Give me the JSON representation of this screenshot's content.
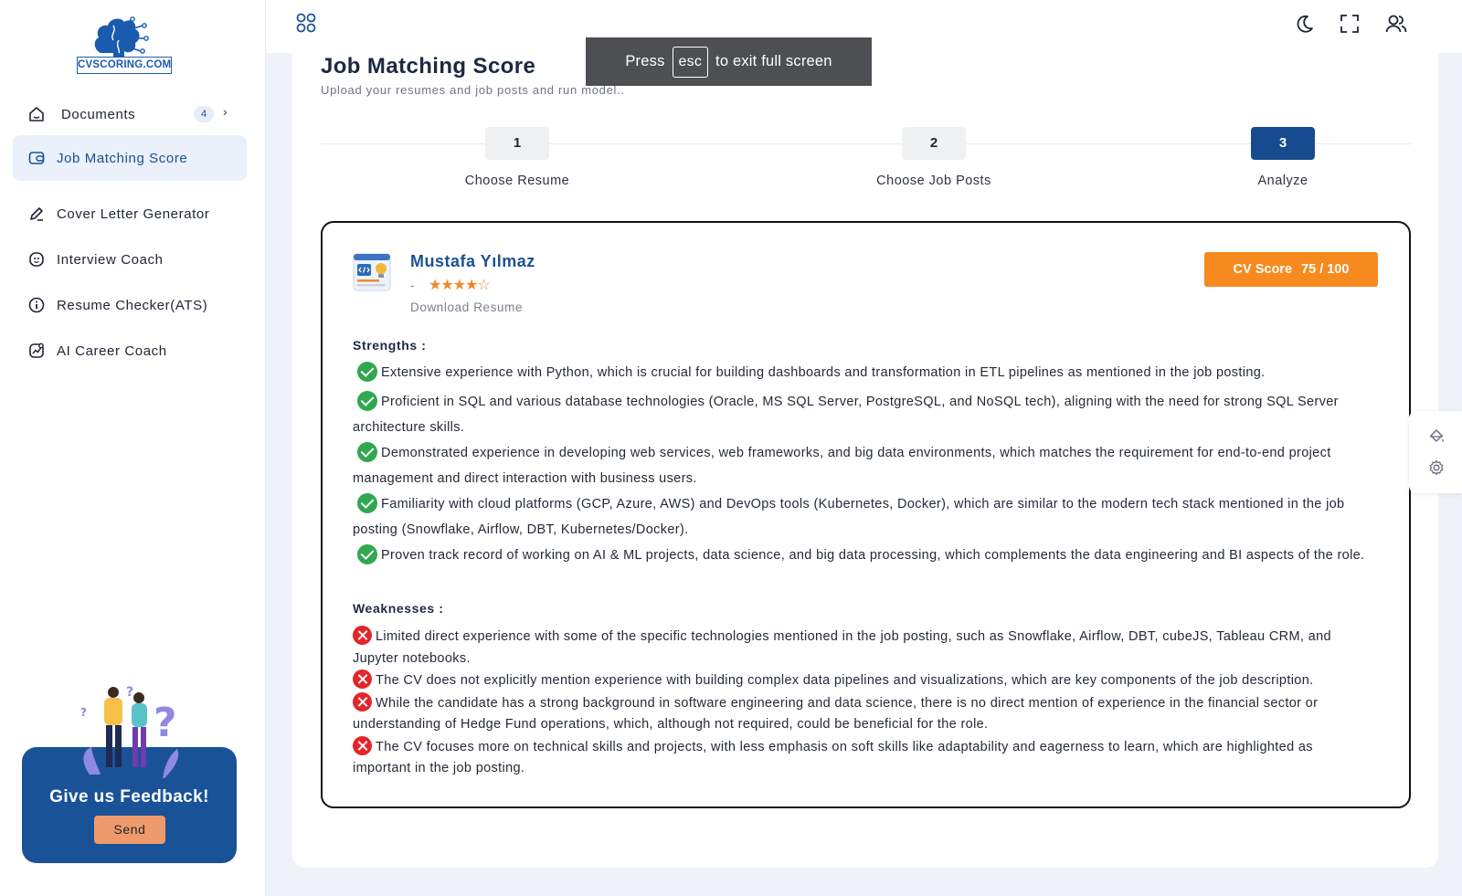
{
  "brand": {
    "logo_text": "CVSCORING.COM"
  },
  "sidebar": {
    "items": [
      {
        "label": "Documents",
        "icon": "home-icon",
        "badge": "4"
      },
      {
        "label": "Job Matching Score",
        "icon": "wallet-icon",
        "active": true
      },
      {
        "label": "Cover Letter Generator",
        "icon": "pen-icon"
      },
      {
        "label": "Interview Coach",
        "icon": "face-icon"
      },
      {
        "label": "Resume Checker(ATS)",
        "icon": "info-icon"
      },
      {
        "label": "AI Career Coach",
        "icon": "chart-icon"
      }
    ],
    "feedback": {
      "title": "Give us Feedback!",
      "button": "Send"
    }
  },
  "topbar": {
    "icons": [
      "apps-icon",
      "moon-icon",
      "fullscreen-icon",
      "users-icon"
    ]
  },
  "toast": {
    "prefix": "Press",
    "key": "esc",
    "suffix": "to exit full screen"
  },
  "page": {
    "title": "Job Matching Score",
    "subtitle": "Upload your resumes and job posts and run model..",
    "steps": [
      {
        "number": "1",
        "label": "Choose Resume"
      },
      {
        "number": "2",
        "label": "Choose Job Posts"
      },
      {
        "number": "3",
        "label": "Analyze",
        "active": true
      }
    ]
  },
  "result": {
    "candidate_name": "Mustafa Yılmaz",
    "dash": "-",
    "stars": "★★★★☆",
    "rating": 4,
    "download_label": "Download Resume",
    "score_label": "CV Score",
    "score_value": "75 / 100",
    "strengths_title": "Strengths :",
    "strengths": [
      "Extensive experience with Python, which is crucial for building dashboards and transformation in ETL pipelines as mentioned in the job posting.",
      "Proficient in SQL and various database technologies (Oracle, MS SQL Server, PostgreSQL, and NoSQL tech), aligning with the need for strong SQL Server architecture skills.",
      "Demonstrated experience in developing web services, web frameworks, and big data environments, which matches the requirement for end-to-end project management and direct interaction with business users.",
      "Familiarity with cloud platforms (GCP, Azure, AWS) and DevOps tools (Kubernetes, Docker), which are similar to the modern tech stack mentioned in the job posting (Snowflake, Airflow, DBT, Kubernetes/Docker).",
      "Proven track record of working on AI & ML projects, data science, and big data processing, which complements the data engineering and BI aspects of the role."
    ],
    "weaknesses_title": "Weaknesses :",
    "weaknesses": [
      "Limited direct experience with some of the specific technologies mentioned in the job posting, such as Snowflake, Airflow, DBT, cubeJS, Tableau CRM, and Jupyter notebooks.",
      "The CV does not explicitly mention experience with building complex data pipelines and visualizations, which are key components of the job description.",
      "While the candidate has a strong background in software engineering and data science, there is no direct mention of experience in the financial sector or understanding of Hedge Fund operations, which, although not required, could be beneficial for the role.",
      "The CV focuses more on technical skills and projects, with less emphasis on soft skills like adaptability and eagerness to learn, which are highlighted as important in the job posting."
    ]
  },
  "colors": {
    "primary": "#1a5298",
    "accent": "#f78a1f",
    "success": "#2fa84f",
    "danger": "#e2262c"
  }
}
